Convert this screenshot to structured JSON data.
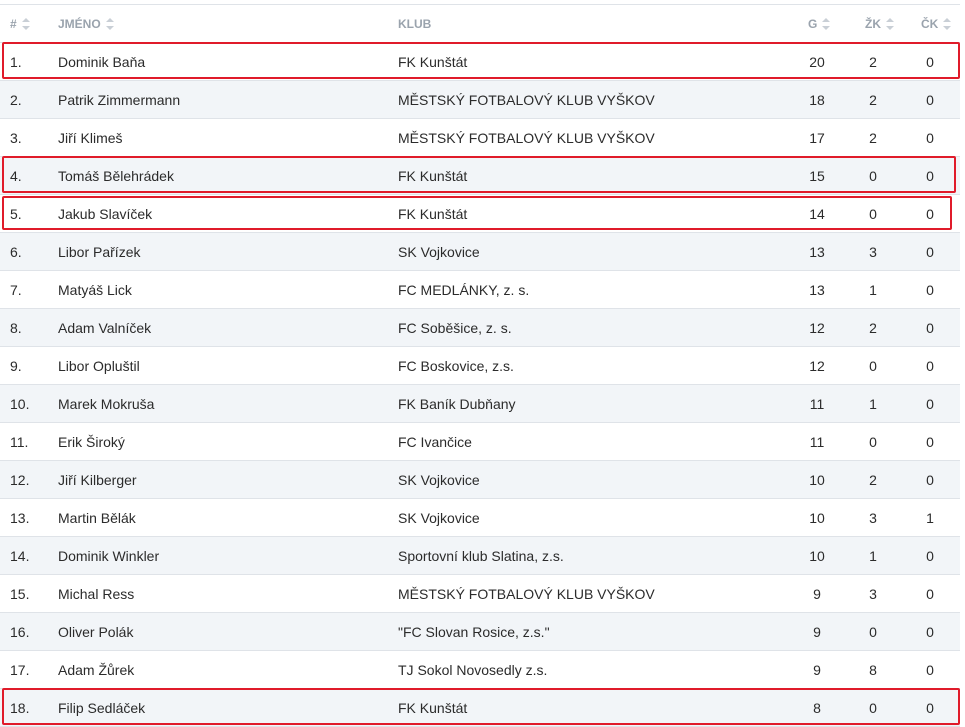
{
  "headers": {
    "num": "#",
    "name": "JMÉNO",
    "club": "KLUB",
    "goals": "G",
    "yellow": "ŽK",
    "red": "ČK"
  },
  "rows": [
    {
      "rank": "1.",
      "name": "Dominik Baňa",
      "club": "FK Kunštát",
      "g": "20",
      "zk": "2",
      "ck": "0"
    },
    {
      "rank": "2.",
      "name": "Patrik Zimmermann",
      "club": "MĚSTSKÝ FOTBALOVÝ KLUB VYŠKOV",
      "g": "18",
      "zk": "2",
      "ck": "0"
    },
    {
      "rank": "3.",
      "name": "Jiří Klimeš",
      "club": "MĚSTSKÝ FOTBALOVÝ KLUB VYŠKOV",
      "g": "17",
      "zk": "2",
      "ck": "0"
    },
    {
      "rank": "4.",
      "name": "Tomáš Bělehrádek",
      "club": "FK Kunštát",
      "g": "15",
      "zk": "0",
      "ck": "0"
    },
    {
      "rank": "5.",
      "name": "Jakub Slavíček",
      "club": "FK Kunštát",
      "g": "14",
      "zk": "0",
      "ck": "0"
    },
    {
      "rank": "6.",
      "name": "Libor Pařízek",
      "club": "SK Vojkovice",
      "g": "13",
      "zk": "3",
      "ck": "0"
    },
    {
      "rank": "7.",
      "name": "Matyáš Lick",
      "club": "FC MEDLÁNKY, z. s.",
      "g": "13",
      "zk": "1",
      "ck": "0"
    },
    {
      "rank": "8.",
      "name": "Adam Valníček",
      "club": "FC Soběšice, z. s.",
      "g": "12",
      "zk": "2",
      "ck": "0"
    },
    {
      "rank": "9.",
      "name": "Libor Opluštil",
      "club": "FC Boskovice, z.s.",
      "g": "12",
      "zk": "0",
      "ck": "0"
    },
    {
      "rank": "10.",
      "name": "Marek Mokruša",
      "club": "FK Baník Dubňany",
      "g": "11",
      "zk": "1",
      "ck": "0"
    },
    {
      "rank": "11.",
      "name": "Erik Široký",
      "club": "FC Ivančice",
      "g": "11",
      "zk": "0",
      "ck": "0"
    },
    {
      "rank": "12.",
      "name": "Jiří Kilberger",
      "club": "SK Vojkovice",
      "g": "10",
      "zk": "2",
      "ck": "0"
    },
    {
      "rank": "13.",
      "name": "Martin Bělák",
      "club": "SK Vojkovice",
      "g": "10",
      "zk": "3",
      "ck": "1"
    },
    {
      "rank": "14.",
      "name": "Dominik Winkler",
      "club": "Sportovní klub Slatina, z.s.",
      "g": "10",
      "zk": "1",
      "ck": "0"
    },
    {
      "rank": "15.",
      "name": "Michal Ress",
      "club": "MĚSTSKÝ FOTBALOVÝ KLUB VYŠKOV",
      "g": "9",
      "zk": "3",
      "ck": "0"
    },
    {
      "rank": "16.",
      "name": "Oliver Polák",
      "club": "\"FC Slovan Rosice, z.s.\"",
      "g": "9",
      "zk": "0",
      "ck": "0"
    },
    {
      "rank": "17.",
      "name": "Adam Žůrek",
      "club": "TJ Sokol Novosedly z.s.",
      "g": "9",
      "zk": "8",
      "ck": "0"
    },
    {
      "rank": "18.",
      "name": "Filip Sedláček",
      "club": "FK Kunštát",
      "g": "8",
      "zk": "0",
      "ck": "0"
    }
  ],
  "colors": {
    "highlight": "#e01b2a",
    "row_alt": "#f2f5f8",
    "header_text": "#9aa3ad"
  },
  "icons": {
    "sort": "sort-icon"
  }
}
